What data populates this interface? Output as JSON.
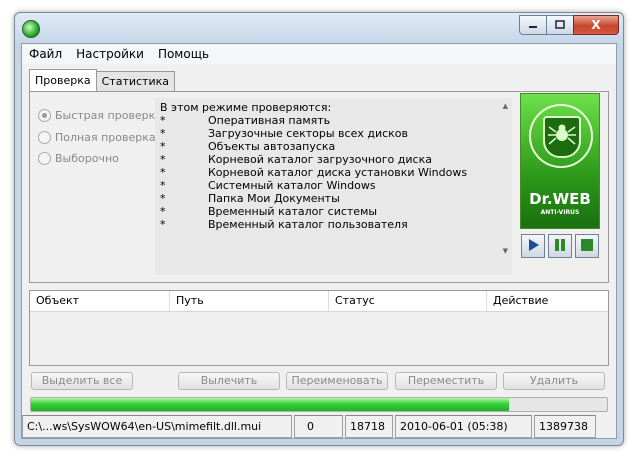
{
  "window": {
    "close_symbol": "X"
  },
  "menu": [
    "Файл",
    "Настройки",
    "Помощь"
  ],
  "tabs": [
    "Проверка",
    "Статистика"
  ],
  "scan_modes": {
    "options": [
      "Быстрая проверка",
      "Полная проверка",
      "Выборочно"
    ],
    "selected": "Быстрая проверка"
  },
  "info": {
    "title": "В этом режиме проверяются:",
    "bullet": "*",
    "items": [
      "Оперативная память",
      "Загрузочные секторы всех дисков",
      "Объекты автозапуска",
      "Корневой каталог загрузочного диска",
      "Корневой каталог диска установки Windows",
      "Системный каталог Windows",
      "Папка Мои Документы",
      "Временный каталог системы",
      "Временный каталог пользователя"
    ]
  },
  "logo": {
    "brand": "Dr.WEB",
    "tagline": "ANTI-VIRUS"
  },
  "results_table": {
    "columns": [
      "Объект",
      "Путь",
      "Статус",
      "Действие"
    ]
  },
  "actions": {
    "select_all": "Выделить все",
    "cure": "Вылечить",
    "rename": "Переименовать",
    "move": "Переместить",
    "delete": "Удалить"
  },
  "progress": {
    "fraction": 0.83
  },
  "status": {
    "current_file": "C:\\...ws\\SysWOW64\\en-US\\mimefilt.dll.mui",
    "infected": "0",
    "checked": "18718",
    "datetime": "2010-06-01 (05:38)",
    "records": "1389738"
  },
  "colors": {
    "accent_green": "#2fc43a",
    "logo_green": "#3aaa22"
  }
}
